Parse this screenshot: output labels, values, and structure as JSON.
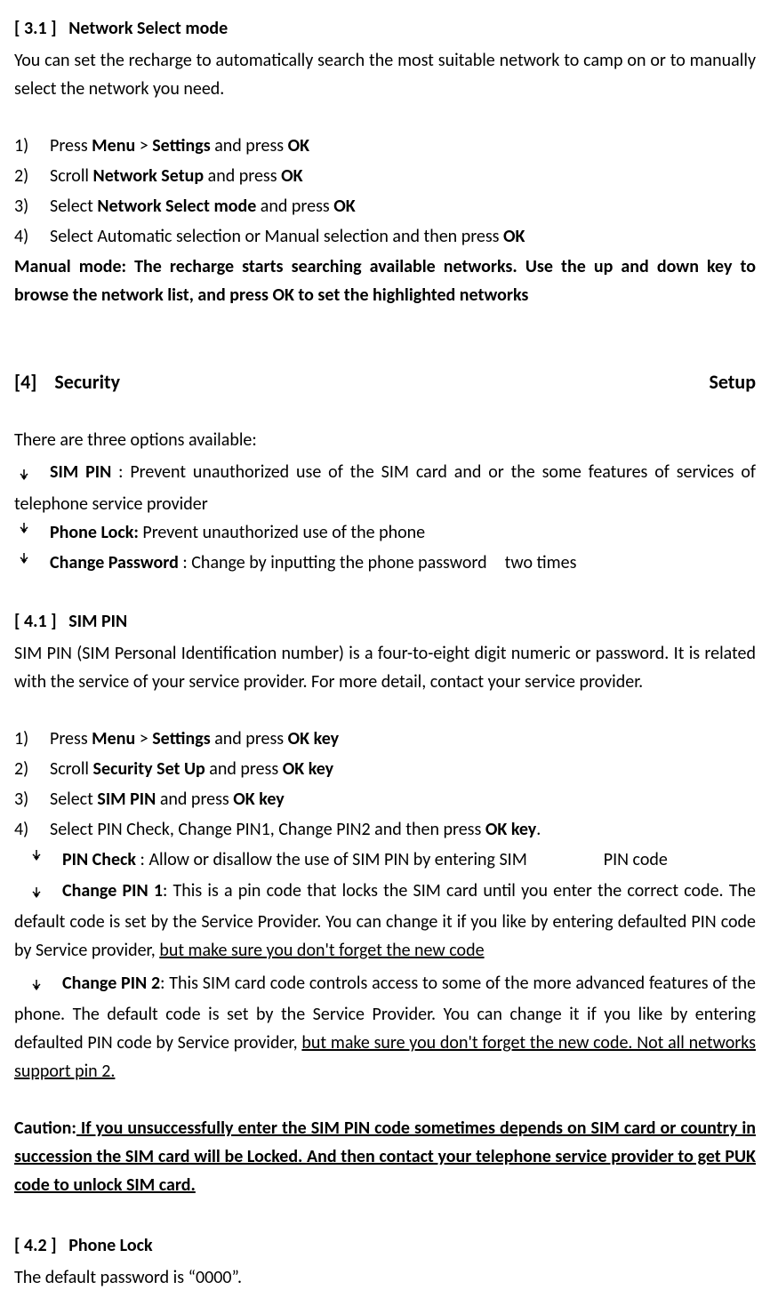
{
  "s31": {
    "title_num": "[ 3.1 ]",
    "title_text": "Network Select mode",
    "intro": "You can set the recharge to automatically search the most suitable network to camp on or to manually select the network you need.",
    "steps": [
      {
        "num": "1)",
        "pre": "Press ",
        "b1": "Menu",
        "mid1": " > ",
        "b2": "Settings",
        "mid2": " and press ",
        "b3": "OK",
        "post": ""
      },
      {
        "num": "2)",
        "pre": "Scroll ",
        "b1": "Network Setup",
        "mid1": " and press ",
        "b2": "OK",
        "mid2": "",
        "b3": "",
        "post": ""
      },
      {
        "num": "3)",
        "pre": "Select ",
        "b1": "Network Select mode",
        "mid1": " and press ",
        "b2": "OK",
        "mid2": "",
        "b3": "",
        "post": ""
      },
      {
        "num": "4)",
        "pre": "Select Automatic selection or Manual selection and then press ",
        "b1": "OK",
        "mid1": "",
        "b2": "",
        "mid2": "",
        "b3": "",
        "post": ""
      }
    ],
    "manual_note": "Manual mode: The recharge starts searching available networks. Use the up and down key to browse the network list, and press OK to set the highlighted networks"
  },
  "s4": {
    "num": "[4]",
    "left": "Security",
    "right": "Setup",
    "intro": "There are three options available:",
    "bullets": [
      {
        "b": "SIM PIN",
        "sep": " : ",
        "text": "Prevent unauthorized use of the SIM card and or the some features of services of telephone service provider"
      },
      {
        "b": "Phone Lock:",
        "sep": " ",
        "text": "Prevent unauthorized use of the phone"
      },
      {
        "b": "Change Password",
        "sep": " : ",
        "text": "Change by inputting the phone password two times"
      }
    ]
  },
  "s41": {
    "title_num": "[ 4.1 ]",
    "title_text": "SIM PIN",
    "intro": "SIM PIN (SIM Personal Identification number) is a four-to-eight digit numeric or password. It is related with the service of your service provider. For more detail, contact your service provider.",
    "steps": [
      {
        "num": "1)",
        "pre": "Press ",
        "b1": "Menu",
        "mid1": " > ",
        "b2": "Settings",
        "mid2": " and press ",
        "b3": "OK key",
        "post": ""
      },
      {
        "num": "2)",
        "pre": "Scroll ",
        "b1": "Security Set Up",
        "mid1": " and press ",
        "b2": "OK key",
        "mid2": "",
        "b3": "",
        "post": ""
      },
      {
        "num": "3)",
        "pre": "Select ",
        "b1": "SIM PIN",
        "mid1": " and press ",
        "b2": "OK key",
        "mid2": "",
        "b3": "",
        "post": ""
      },
      {
        "num": "4)",
        "pre": "Select PIN Check, Change PIN1, Change PIN2 and then press ",
        "b1": "OK key",
        "mid1": "",
        "b2": "",
        "mid2": "",
        "b3": "",
        "post": "."
      }
    ],
    "sub_bullets": {
      "pin_check": {
        "b": "PIN Check",
        "sep": " : ",
        "t1": "Allow or disallow the use of SIM PIN by entering SIM",
        "gap": "                   ",
        "t2": "PIN code"
      },
      "pin1": {
        "b": "Change PIN 1",
        "sep": ": ",
        "t1": "This is a pin code that locks the SIM card until you enter the correct code. The default code is set by the Service Provider. You can change it if you like by entering defaulted PIN code by Service provider, ",
        "u1": "but make sure you don't forget the new code"
      },
      "pin2": {
        "b": "Change PIN 2",
        "sep": ": ",
        "t1": "This SIM card code controls access to some of the more advanced features of the phone. The default code is set by the Service Provider. You can change it if you like by entering defaulted PIN code by Service provider, ",
        "u1": "but make sure you don't forget the new code. Not all networks support pin 2."
      }
    },
    "caution": {
      "label": "Caution:",
      "u1": " If you unsuccessfully enter the SIM PIN code sometimes depends on SIM card or country in succession the SIM card",
      "mid": " will be Locked. And then contact your telephone service provider to get PUK code to unlock SIM card."
    }
  },
  "s42": {
    "title_num": "[ 4.2 ]",
    "title_text": "Phone Lock",
    "intro": "The default password is “0000”."
  }
}
